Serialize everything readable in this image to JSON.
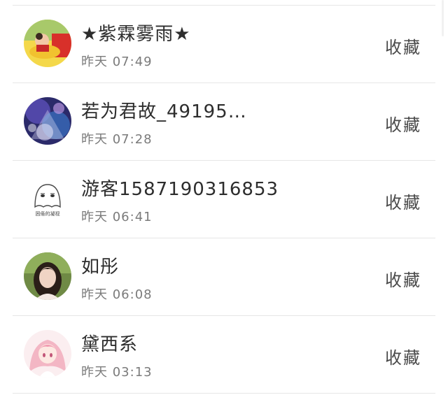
{
  "contacts": [
    {
      "name": "★紫霖雾雨★",
      "time": "昨天 07:49",
      "action": "收藏",
      "avatar_icon": "child-photo-avatar"
    },
    {
      "name": "若为君故_49195…",
      "time": "昨天 07:28",
      "action": "收藏",
      "avatar_icon": "galaxy-art-avatar"
    },
    {
      "name": "游客1587190316853",
      "time": "昨天 06:41",
      "action": "收藏",
      "avatar_icon": "cartoon-ghost-avatar",
      "avatar_caption": "困倦的凝视"
    },
    {
      "name": "如彤",
      "time": "昨天 06:08",
      "action": "收藏",
      "avatar_icon": "portrait-avatar"
    },
    {
      "name": "黛西系",
      "time": "昨天 03:13",
      "action": "收藏",
      "avatar_icon": "anime-girl-avatar"
    }
  ],
  "colors": {
    "divider": "#e6e6e6",
    "name_text": "#2d2d2d",
    "time_text": "#7b7b7b",
    "action_text": "#4a4a4a"
  }
}
